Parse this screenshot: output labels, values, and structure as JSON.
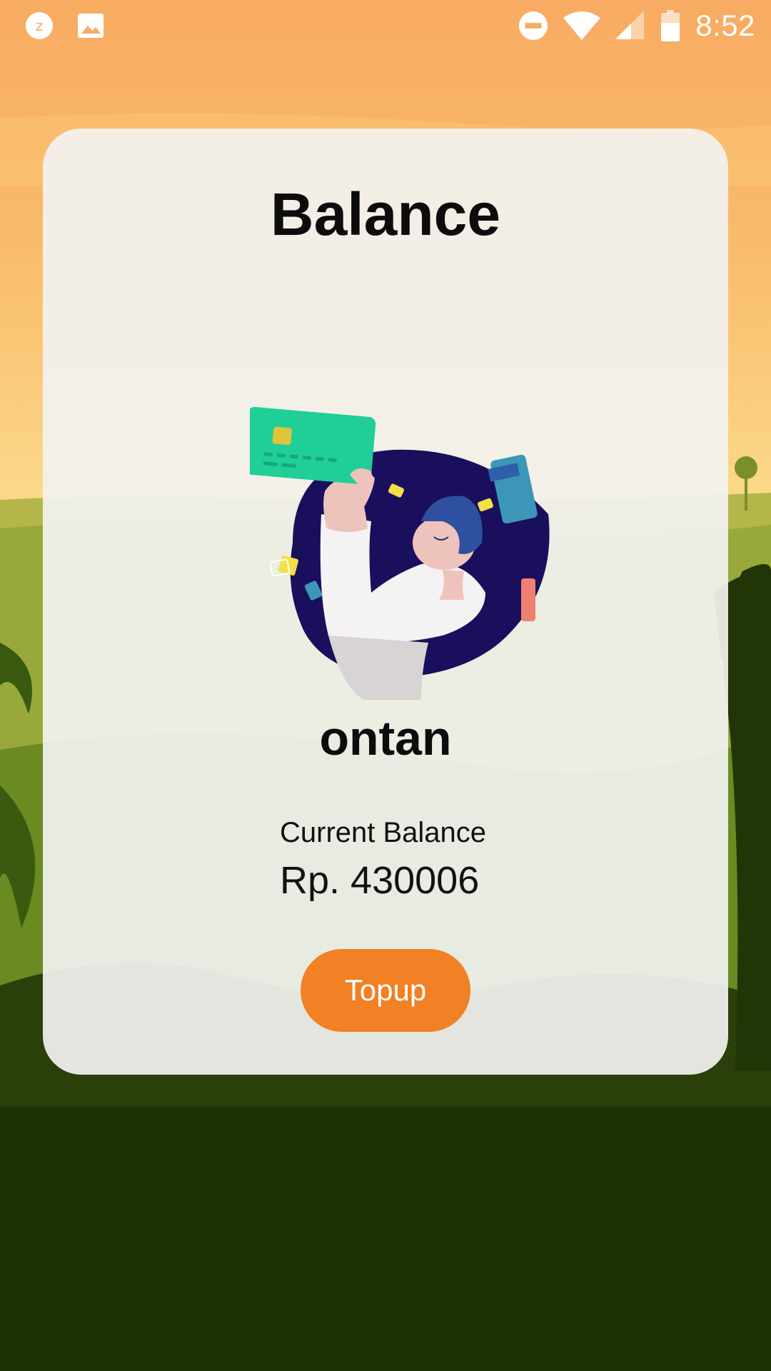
{
  "status_bar": {
    "left_icons": [
      "notification-z-icon",
      "image-icon"
    ],
    "right_icons": [
      "do-not-disturb-icon",
      "wifi-icon",
      "cellular-signal-icon",
      "battery-icon"
    ],
    "time": "8:52"
  },
  "card": {
    "title": "Balance",
    "illustration": "person-holding-card-illustration",
    "username": "ontan",
    "balance_label": "Current Balance",
    "balance_value": "Rp. 430006",
    "topup_label": "Topup"
  },
  "colors": {
    "accent": "#f28024",
    "sky_top": "#f8ab62",
    "jungle_dark": "#1f3205"
  }
}
